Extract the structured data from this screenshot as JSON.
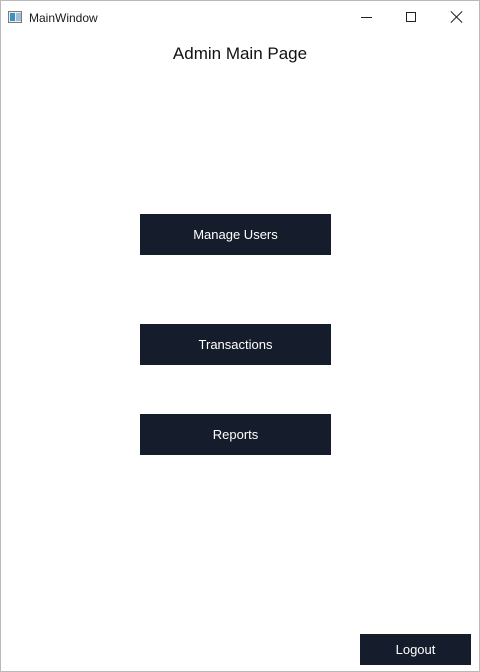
{
  "window": {
    "title": "MainWindow",
    "icon": "app-window-icon",
    "controls": {
      "minimize_icon": "minimize-icon",
      "maximize_icon": "maximize-icon",
      "close_icon": "close-icon"
    }
  },
  "page": {
    "title": "Admin Main Page"
  },
  "buttons": {
    "manage_users": "Manage Users",
    "transactions": "Transactions",
    "reports": "Reports",
    "logout": "Logout"
  },
  "colors": {
    "button_bg": "#151c2b",
    "button_text": "#ffffff",
    "background": "#ffffff"
  }
}
